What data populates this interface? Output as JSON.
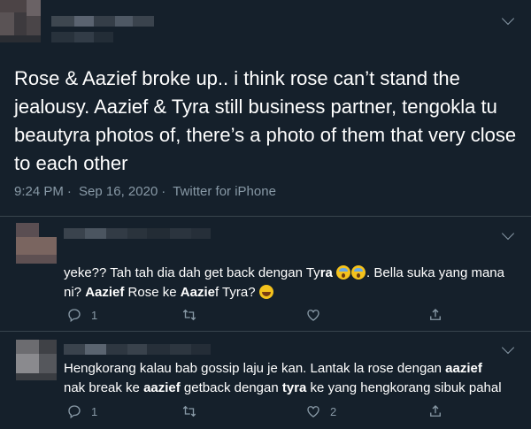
{
  "tweet": {
    "text": "Rose & Aazief broke up.. i think rose can’t stand the jealousy. Aazief & Tyra still business partner, tengokla tu beautyra photos of, there’s a photo of them that very close to each other",
    "time": "9:24 PM",
    "date": "Sep 16, 2020",
    "source": "Twitter for iPhone",
    "separator": "·"
  },
  "replies": [
    {
      "parts": {
        "p1": "yeke?? Tah tah dia dah get back dengan Ty",
        "p2": "ra",
        "p3": ". Bella suka yang mana ni?",
        "p4": "Aazief",
        "p5": " Rose ke ",
        "p6": "Aazie",
        "p7": "f Tyra?"
      },
      "emoji": [
        "screaming-face",
        "screaming-face",
        "tears-of-joy"
      ],
      "reply_count": "1",
      "like_count": ""
    },
    {
      "parts": {
        "p1": "Hengkorang kalau bab gossip laju je kan. Lantak la rose dengan ",
        "p2": "aazief",
        "p3": "nak break ke ",
        "p4": "aazief",
        "p5": " getback dengan ",
        "p6": "tyra",
        "p7": " ke yang hengkorang sibuk pahal"
      },
      "reply_count": "1",
      "like_count": "2"
    }
  ],
  "colors": {
    "background": "#15202b",
    "text": "#ffffff",
    "secondary": "#8899a6",
    "divider": "#38444d"
  },
  "icons": [
    "reply-icon",
    "retweet-icon",
    "like-icon",
    "share-icon",
    "chevron-down-icon"
  ]
}
